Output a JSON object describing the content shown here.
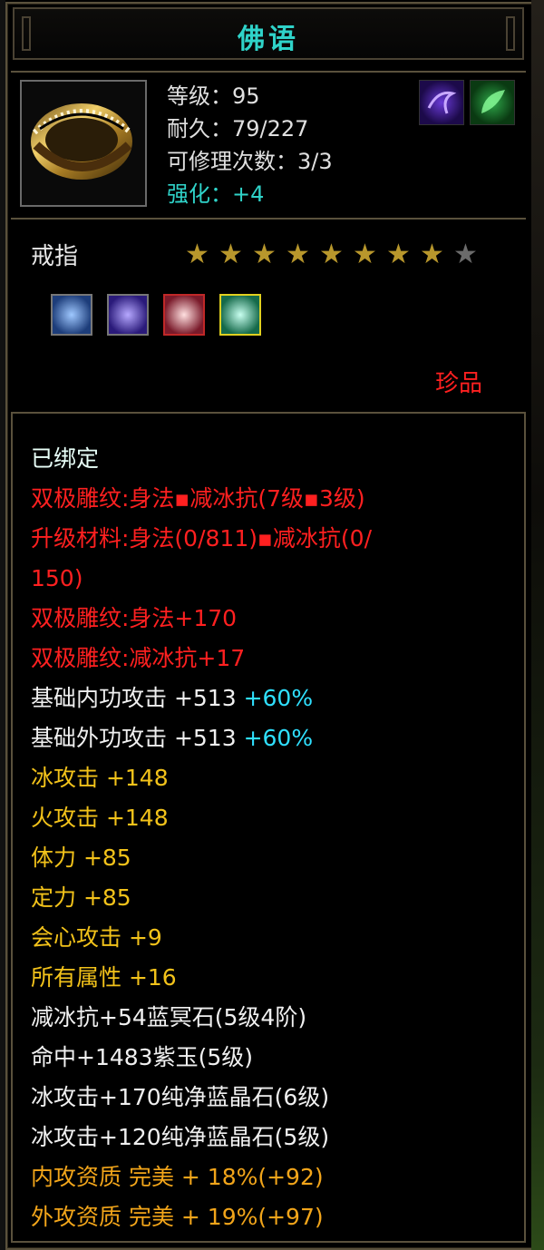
{
  "title": "佛语",
  "item": {
    "level": "等级：95",
    "durability": "耐久：79/227",
    "repair": "可修理次数：3/3",
    "enhance": "强化：+4",
    "type": "戒指",
    "stars_filled": 8,
    "stars_total": 9,
    "rarity": "珍品",
    "skill_icons": [
      "purple-swirl-icon",
      "green-leaf-icon"
    ],
    "gems": [
      "blue-crystal-gem-icon",
      "violet-crystal-gem-icon",
      "red-crystal-gem-icon",
      "green-crystal-gem-icon"
    ]
  },
  "attributes": {
    "bound": "已绑定",
    "line1": "双极雕纹:身法▪减冰抗(7级▪3级)",
    "line2a": "升级材料:身法(0/811)▪减冰抗(0/",
    "line2b": "150)",
    "line3": "双极雕纹:身法+170",
    "line4": "双极雕纹:减冰抗+17",
    "inner_attack": "基础内功攻击  +513",
    "inner_attack_pct": "+60%",
    "outer_attack": "基础外功攻击  +513",
    "outer_attack_pct": "+60%",
    "ice_attack": "冰攻击  +148",
    "fire_attack": "火攻击  +148",
    "stamina": "体力  +85",
    "focus": "定力  +85",
    "crit": "会心攻击  +9",
    "all_attr": "所有属性  +16",
    "gem1": "减冰抗+54蓝冥石(5级4阶)",
    "gem2": "命中+1483紫玉(5级)",
    "gem3": "冰攻击+170纯净蓝晶石(6级)",
    "gem4": "冰攻击+120纯净蓝晶石(5级)",
    "inner_quality": "内攻资质  完美  + 18%(+92)",
    "outer_quality": "外攻资质  完美  + 19%(+97)"
  },
  "colors": {
    "title": "#2fd3c9",
    "enhance": "#2fd3c9",
    "red": "#ff2020",
    "yellow": "#f2c21a",
    "orange": "#f2a51a",
    "cyan": "#2fe0ff",
    "star_on": "#b8972c",
    "star_off": "#6b6b6b"
  }
}
